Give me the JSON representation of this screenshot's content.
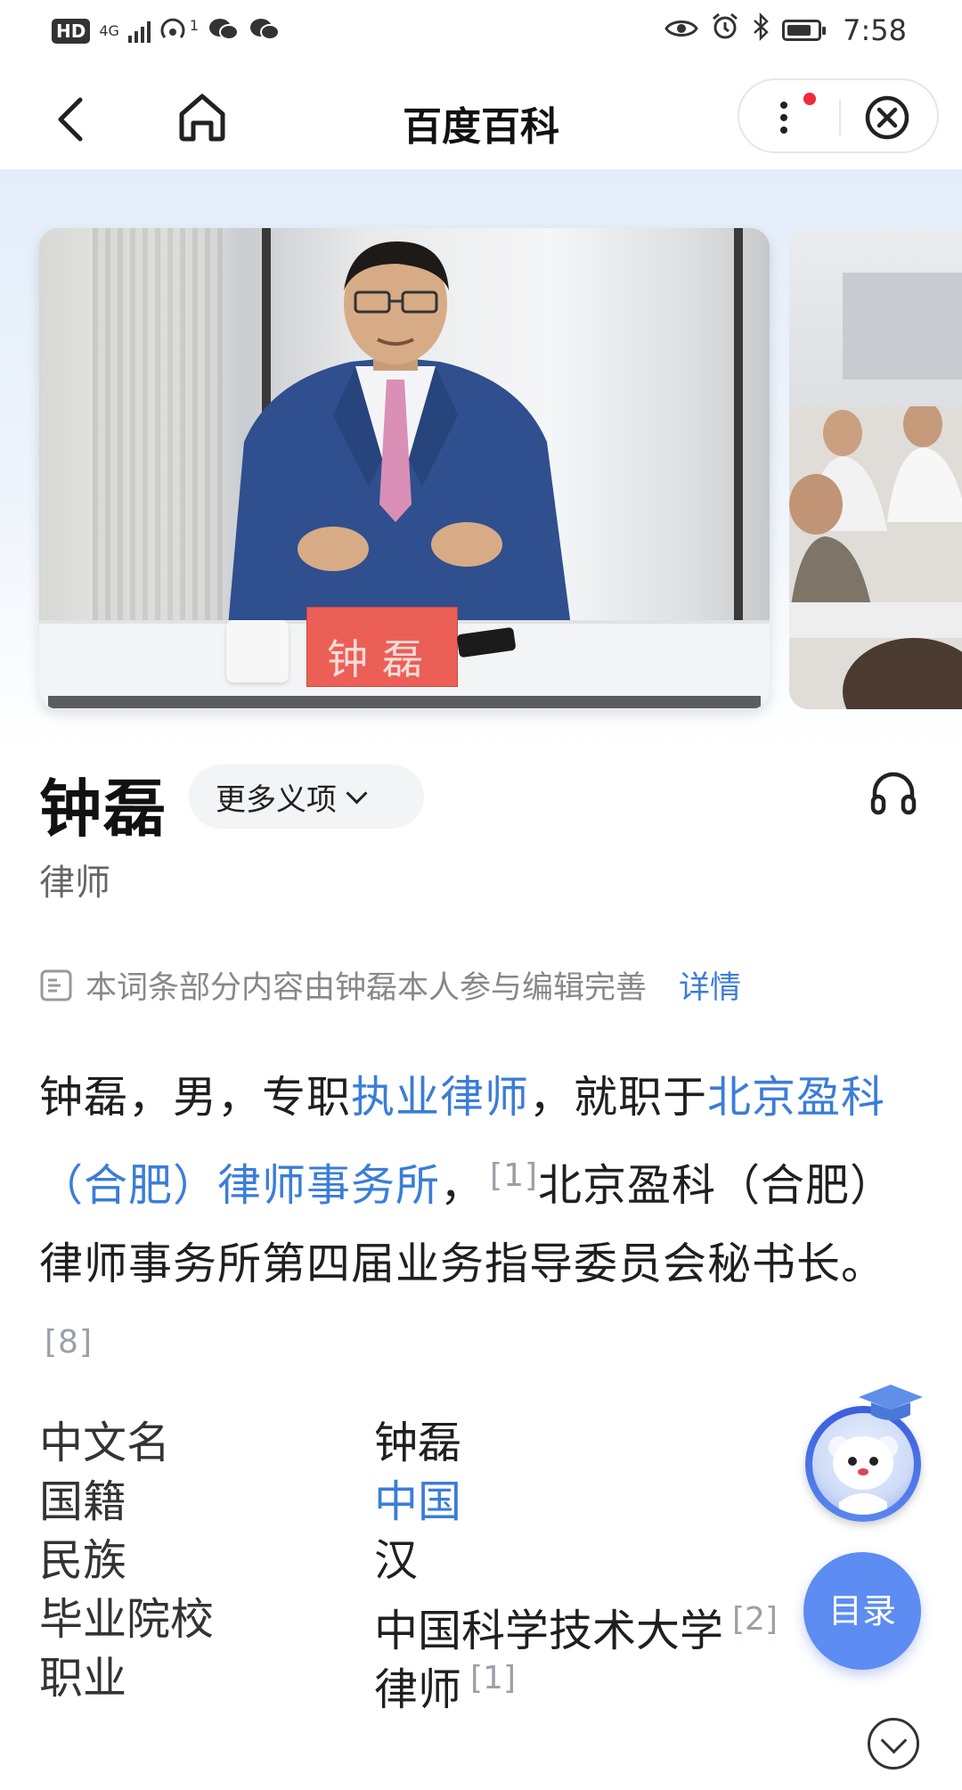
{
  "status_bar": {
    "hd": "HD",
    "network": "4G",
    "wifi_count": "1",
    "time": "7:58"
  },
  "nav": {
    "title": "百度百科",
    "icons": [
      "back-arrow-icon",
      "home-icon",
      "more-dots-icon",
      "close-circle-icon"
    ]
  },
  "entry": {
    "name": "钟磊",
    "more_meanings": "更多义项",
    "subtitle": "律师",
    "name_card_text": "钟磊",
    "notice": "本词条部分内容由钟磊本人参与编辑完善",
    "notice_link": "详情"
  },
  "summary": {
    "p1": "钟磊，男，专职",
    "link1": "执业律师",
    "p2": "，就职于",
    "link2": "北京盈科（合肥）律师事务所",
    "p3": "，",
    "ref1": "[1]",
    "p4": "北京盈科（合肥）律师事务所第四届业务指导委员会秘书长。",
    "ref2": "[8]"
  },
  "info": [
    {
      "key": "中文名",
      "value": "钟磊",
      "ref": ""
    },
    {
      "key": "国籍",
      "value": "中国",
      "ref": "",
      "link": true
    },
    {
      "key": "民族",
      "value": "汉",
      "ref": ""
    },
    {
      "key": "毕业院校",
      "value": "中国科学技术大学",
      "ref": "[2]"
    },
    {
      "key": "职业",
      "value": "律师",
      "ref": "[1]"
    }
  ],
  "floating": {
    "toc_label": "目录"
  },
  "colors": {
    "link": "#3b7dd8",
    "toc": "#5d8cf3",
    "red_dot": "#f0293b"
  }
}
